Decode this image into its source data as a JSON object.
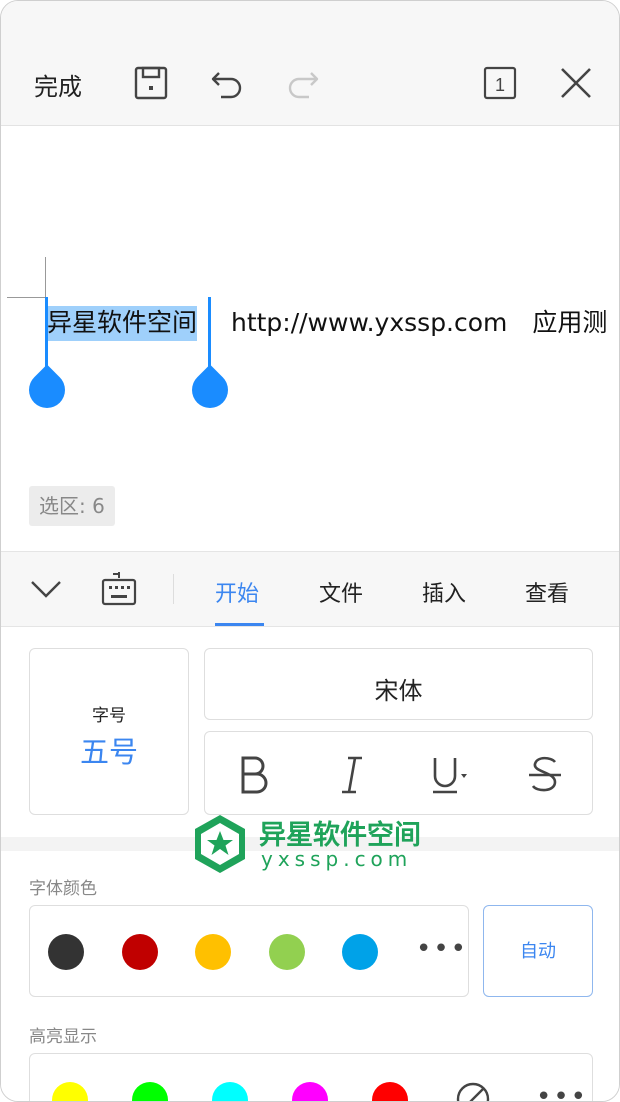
{
  "toolbar": {
    "done_label": "完成",
    "page_indicator": "1"
  },
  "document": {
    "selected_text": "异星软件空间",
    "rest_text": "http://www.yxssp.com　应用测",
    "selection_badge": "选区: 6"
  },
  "tabs": [
    {
      "label": "开始",
      "active": true
    },
    {
      "label": "文件",
      "active": false
    },
    {
      "label": "插入",
      "active": false
    },
    {
      "label": "查看",
      "active": false
    }
  ],
  "font_panel": {
    "size_label": "字号",
    "size_value": "五号",
    "font_name": "宋体"
  },
  "font_color": {
    "title": "字体颜色",
    "swatches": [
      "#333333",
      "#c00000",
      "#ffc000",
      "#92d050",
      "#00a2e8"
    ],
    "more_label": "•••",
    "auto_label": "自动"
  },
  "highlight": {
    "title": "高亮显示",
    "swatches": [
      "#ffff00",
      "#00ff00",
      "#00ffff",
      "#ff00ff",
      "#ff0000"
    ],
    "more_label": "•••"
  },
  "watermark": {
    "line1": "异星软件空间",
    "line2": "yxssp.com"
  },
  "colors": {
    "accent": "#3b86f0",
    "selection_handle": "#1a8cff",
    "selection_fill": "#9fd0fb"
  }
}
